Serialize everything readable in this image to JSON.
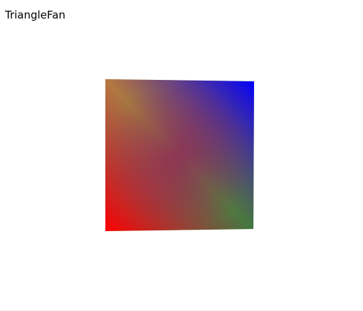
{
  "window": {
    "title": "TriangleFan"
  },
  "shape": {
    "type": "triangle-fan",
    "vertex_colors": {
      "top_left": "#f2f000",
      "top_right": "#0000ff",
      "bottom_left": "#ff0000",
      "bottom_right": "#00f000",
      "center": "#990066"
    }
  }
}
